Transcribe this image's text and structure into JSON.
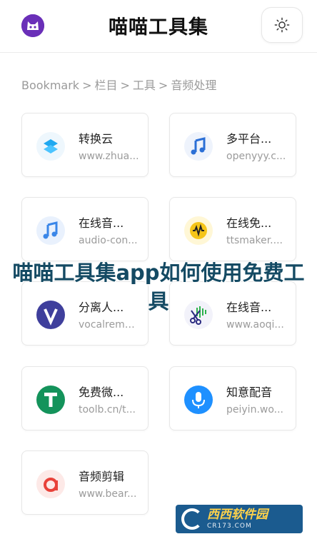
{
  "header": {
    "title": "喵喵工具集",
    "logo_icon": "cat-logo-icon",
    "theme_icon": "sun-icon"
  },
  "breadcrumb": [
    "Bookmark",
    "栏目",
    "工具",
    "音频处理"
  ],
  "breadcrumb_separator": ">",
  "cards": [
    {
      "name": "转换云",
      "url": "www.zhua...",
      "icon": "stack-layers-icon",
      "color": "#1fa8f0"
    },
    {
      "name": "多平台...",
      "url": "openyyy.c...",
      "icon": "music-note-icon",
      "color": "#2b6fd6"
    },
    {
      "name": "在线音...",
      "url": "audio-con...",
      "icon": "music-note-icon",
      "color": "#3a86e8"
    },
    {
      "name": "在线免...",
      "url": "ttsmaker....",
      "icon": "waveform-icon",
      "color": "#f5c518"
    },
    {
      "name": "分离人...",
      "url": "vocalremo...",
      "icon": "v-letter-icon",
      "color": "#3f3f9c"
    },
    {
      "name": "在线音...",
      "url": "www.aoqi...",
      "icon": "scissors-wave-icon",
      "color": "#2a2a80"
    },
    {
      "name": "免费微...",
      "url": "toolb.cn/t...",
      "icon": "t-letter-icon",
      "color": "#14935b"
    },
    {
      "name": "知意配音",
      "url": "peiyin.wo...",
      "icon": "microphone-icon",
      "color": "#1e90ff"
    },
    {
      "name": "音频剪辑",
      "url": "www.bear...",
      "icon": "a-letter-icon",
      "color": "#e8423a"
    }
  ],
  "overlay": {
    "title": "喵喵工具集app如何使用免费工具"
  },
  "watermark": {
    "main": "西西软件园",
    "sub": "CR173.COM"
  }
}
